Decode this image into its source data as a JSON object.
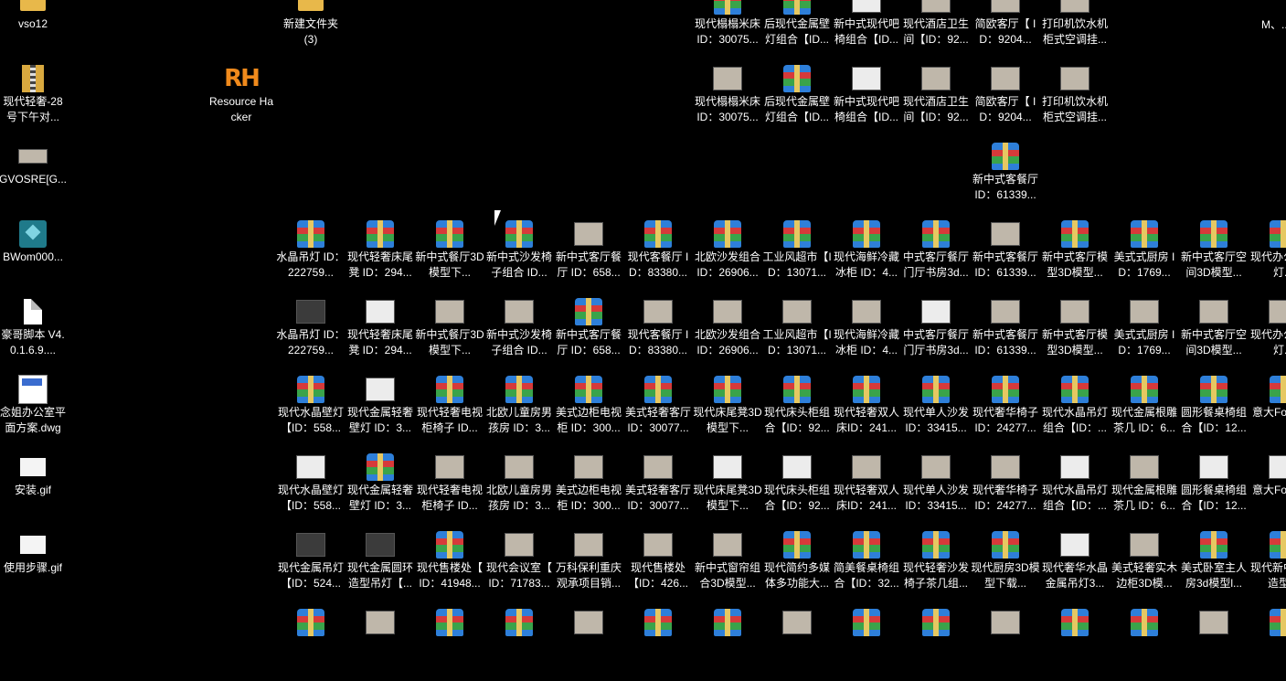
{
  "desktop": {
    "left_icons": [
      {
        "label": "vso12",
        "type": "folder"
      },
      {
        "label": "现代轻奢-28号下午对...",
        "type": "zipfolder"
      },
      {
        "label": "GVOSRE[G...",
        "type": "thumb"
      },
      {
        "label": "BWom000...",
        "type": "max"
      },
      {
        "label": "豪哥脚本 V4.0.1.6.9....",
        "type": "doc"
      },
      {
        "label": "念姐办公室平面方案.dwg",
        "type": "dwg"
      },
      {
        "label": "安装.gif",
        "type": "gif"
      },
      {
        "label": "使用步骤.gif",
        "type": "gif"
      }
    ],
    "folder_new": {
      "label": "新建文件夹 (3)"
    },
    "resource_hacker": {
      "label": "Resource Hacker",
      "icon_text": "RH"
    },
    "top_rows": [
      [
        "现代榻榻米床 ID：30075...",
        "后现代金属壁灯组合【ID...",
        "新中式现代吧椅组合【ID...",
        "现代酒店卫生间【ID：92...",
        "简欧客厅【 ID：9204...",
        "打印机饮水机柜式空调挂..."
      ],
      [
        "现代榻榻米床 ID：30075...",
        "后现代金属壁灯组合【ID...",
        "新中式现代吧椅组合【ID...",
        "现代酒店卫生间【ID：92...",
        "简欧客厅【 ID：9204...",
        "打印机饮水机柜式空调挂..."
      ]
    ],
    "top_right_label": "M、...",
    "single": {
      "label": "新中式客餐厅 ID：61339..."
    },
    "grid_rows": [
      [
        "水晶吊灯 ID：222759...",
        "现代轻奢床尾凳 ID：294...",
        "新中式餐厅3D模型下...",
        "新中式沙发椅子组合 ID...",
        "新中式客厅餐厅 ID：658...",
        "现代客餐厅 ID：83380...",
        "北欧沙发组合 ID：26906...",
        "工业风超市【ID：13071...",
        "现代海鲜冷藏冰柜 ID：4...",
        "中式客厅餐厅门厅书房3d...",
        "新中式客餐厅 ID：61339...",
        "新中式客厅模型3D模型...",
        "美式式厨房 ID：1769...",
        "新中式客厅空间3D模型...",
        "现代办公形吊灯..."
      ],
      [
        "水晶吊灯 ID：222759...",
        "现代轻奢床尾凳 ID：294...",
        "新中式餐厅3D模型下...",
        "新中式沙发椅子组合 ID...",
        "新中式客厅餐厅 ID：658...",
        "现代客餐厅 ID：83380...",
        "北欧沙发组合 ID：26906...",
        "工业风超市【ID：13071...",
        "现代海鲜冷藏冰柜 ID：4...",
        "中式客厅餐厅门厅书房3d...",
        "新中式客餐厅 ID：61339...",
        "新中式客厅模型3D模型...",
        "美式式厨房 ID：1769...",
        "新中式客厅空间3D模型...",
        "现代办公形吊灯..."
      ],
      [
        "现代水晶壁灯【ID：558...",
        "现代金属轻奢壁灯 ID：3...",
        "现代轻奢电视柜椅子 ID...",
        "北欧儿童房男孩房 ID：3...",
        "美式边柜电视柜 ID：300...",
        "美式轻奢客厅 ID：30077...",
        "现代床尾凳3D模型下...",
        "现代床头柜组合【ID：92...",
        "现代轻奢双人床ID：241...",
        "现代单人沙发 ID：33415...",
        "现代奢华椅子 ID：24277...",
        "现代水晶吊灯组合【ID：...",
        "现代金属根雕茶几 ID：6...",
        "圆形餐桌椅组合【ID：12...",
        "意大Formit..."
      ],
      [
        "现代水晶壁灯【ID：558...",
        "现代金属轻奢壁灯 ID：3...",
        "现代轻奢电视柜椅子 ID...",
        "北欧儿童房男孩房 ID：3...",
        "美式边柜电视柜 ID：300...",
        "美式轻奢客厅 ID：30077...",
        "现代床尾凳3D模型下...",
        "现代床头柜组合【ID：92...",
        "现代轻奢双人床ID：241...",
        "现代单人沙发 ID：33415...",
        "现代奢华椅子 ID：24277...",
        "现代水晶吊灯组合【ID：...",
        "现代金属根雕茶几 ID：6...",
        "圆形餐桌椅组合【ID：12...",
        "意大Formit..."
      ],
      [
        "现代金属吊灯【ID：524...",
        "现代金属圆环造型吊灯【...",
        "现代售楼处【 ID：41948...",
        "现代会议室【 ID：71783...",
        "万科保利重庆观承项目销...",
        "现代售楼处 【ID：426...",
        "新中式窗帘组合3D模型...",
        "现代简约多媒体多功能大...",
        "简美餐桌椅组合【ID：32...",
        "现代轻奢沙发椅子茶几组...",
        "现代厨房3D模型下载...",
        "现代奢华水晶金属吊灯3...",
        "美式轻奢实木边柜3D模...",
        "美式卧室主人房3d模型l...",
        "现代新中式子造型..."
      ]
    ]
  }
}
